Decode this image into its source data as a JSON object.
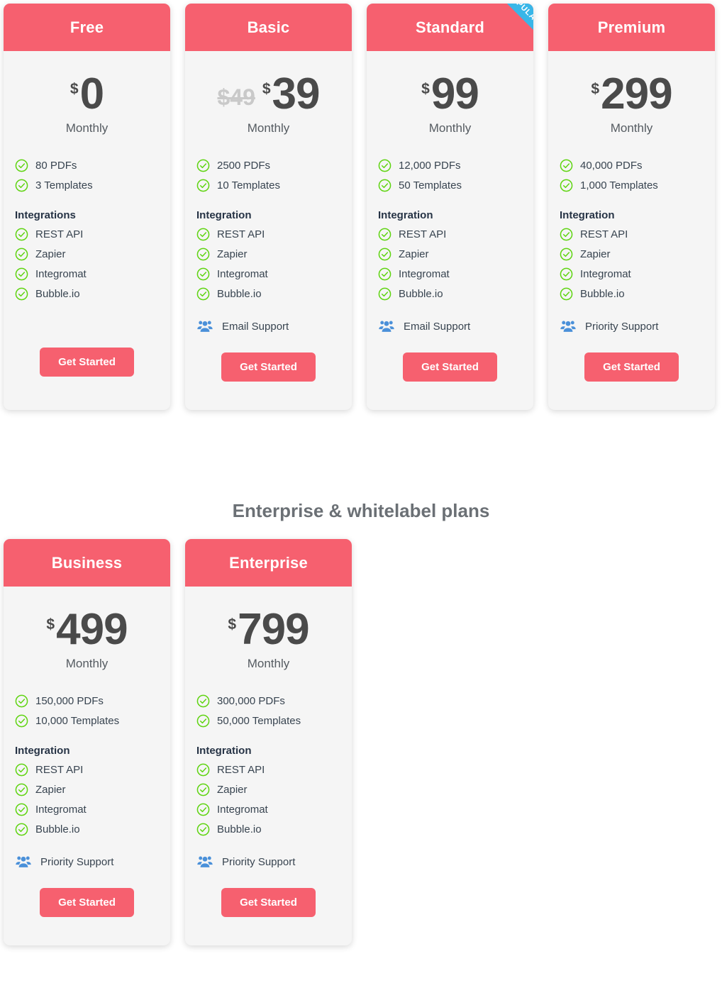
{
  "section_heading": "Enterprise & whitelabel plans",
  "colors": {
    "accent": "#f6606f",
    "ribbon": "#38b6e8",
    "check": "#5fd411",
    "support_icon": "#4a90d9",
    "card_bg": "#f5f5f5",
    "price_text": "#4a4a4a"
  },
  "labels": {
    "popular_ribbon": "POPULAR",
    "currency": "$",
    "period": "Monthly",
    "cta": "Get Started",
    "check_icon_name": "check-circle-icon",
    "support_icon_name": "users-group-icon"
  },
  "plans": [
    {
      "name": "Free",
      "old_price": "",
      "price": "0",
      "period": "Monthly",
      "popular": false,
      "quota": [
        "80 PDFs",
        "3 Templates"
      ],
      "integration_title": "Integrations",
      "integrations": [
        "REST API",
        "Zapier",
        "Integromat",
        "Bubble.io"
      ],
      "support": "",
      "cta": "Get Started"
    },
    {
      "name": "Basic",
      "old_price": "$49",
      "price": "39",
      "period": "Monthly",
      "popular": false,
      "quota": [
        "2500 PDFs",
        "10 Templates"
      ],
      "integration_title": "Integration",
      "integrations": [
        "REST API",
        "Zapier",
        "Integromat",
        "Bubble.io"
      ],
      "support": "Email Support",
      "cta": "Get Started"
    },
    {
      "name": "Standard",
      "old_price": "",
      "price": "99",
      "period": "Monthly",
      "popular": true,
      "quota": [
        "12,000 PDFs",
        "50 Templates"
      ],
      "integration_title": "Integration",
      "integrations": [
        "REST API",
        "Zapier",
        "Integromat",
        "Bubble.io"
      ],
      "support": "Email Support",
      "cta": "Get Started"
    },
    {
      "name": "Premium",
      "old_price": "",
      "price": "299",
      "period": "Monthly",
      "popular": false,
      "quota": [
        "40,000 PDFs",
        "1,000 Templates"
      ],
      "integration_title": "Integration",
      "integrations": [
        "REST API",
        "Zapier",
        "Integromat",
        "Bubble.io"
      ],
      "support": "Priority Support",
      "cta": "Get Started"
    },
    {
      "name": "Business",
      "old_price": "",
      "price": "499",
      "period": "Monthly",
      "popular": false,
      "quota": [
        "150,000 PDFs",
        "10,000 Templates"
      ],
      "integration_title": "Integration",
      "integrations": [
        "REST API",
        "Zapier",
        "Integromat",
        "Bubble.io"
      ],
      "support": "Priority Support",
      "cta": "Get Started"
    },
    {
      "name": "Enterprise",
      "old_price": "",
      "price": "799",
      "period": "Monthly",
      "popular": false,
      "quota": [
        "300,000 PDFs",
        "50,000 Templates"
      ],
      "integration_title": "Integration",
      "integrations": [
        "REST API",
        "Zapier",
        "Integromat",
        "Bubble.io"
      ],
      "support": "Priority Support",
      "cta": "Get Started"
    }
  ]
}
